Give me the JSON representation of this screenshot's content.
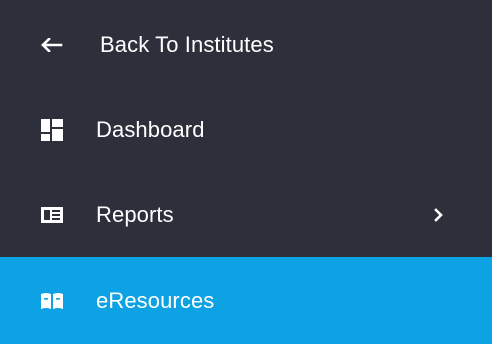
{
  "nav": {
    "back": {
      "label": "Back To Institutes",
      "icon": "arrow-left-icon"
    },
    "items": [
      {
        "label": "Dashboard",
        "icon": "dashboard-icon"
      },
      {
        "label": "Reports",
        "icon": "reports-icon",
        "has_submenu": true
      },
      {
        "label": "eResources",
        "icon": "book-open-icon",
        "active": true
      }
    ]
  },
  "colors": {
    "background": "#2d2f3b",
    "active": "#0da2e4",
    "text": "#ffffff"
  }
}
